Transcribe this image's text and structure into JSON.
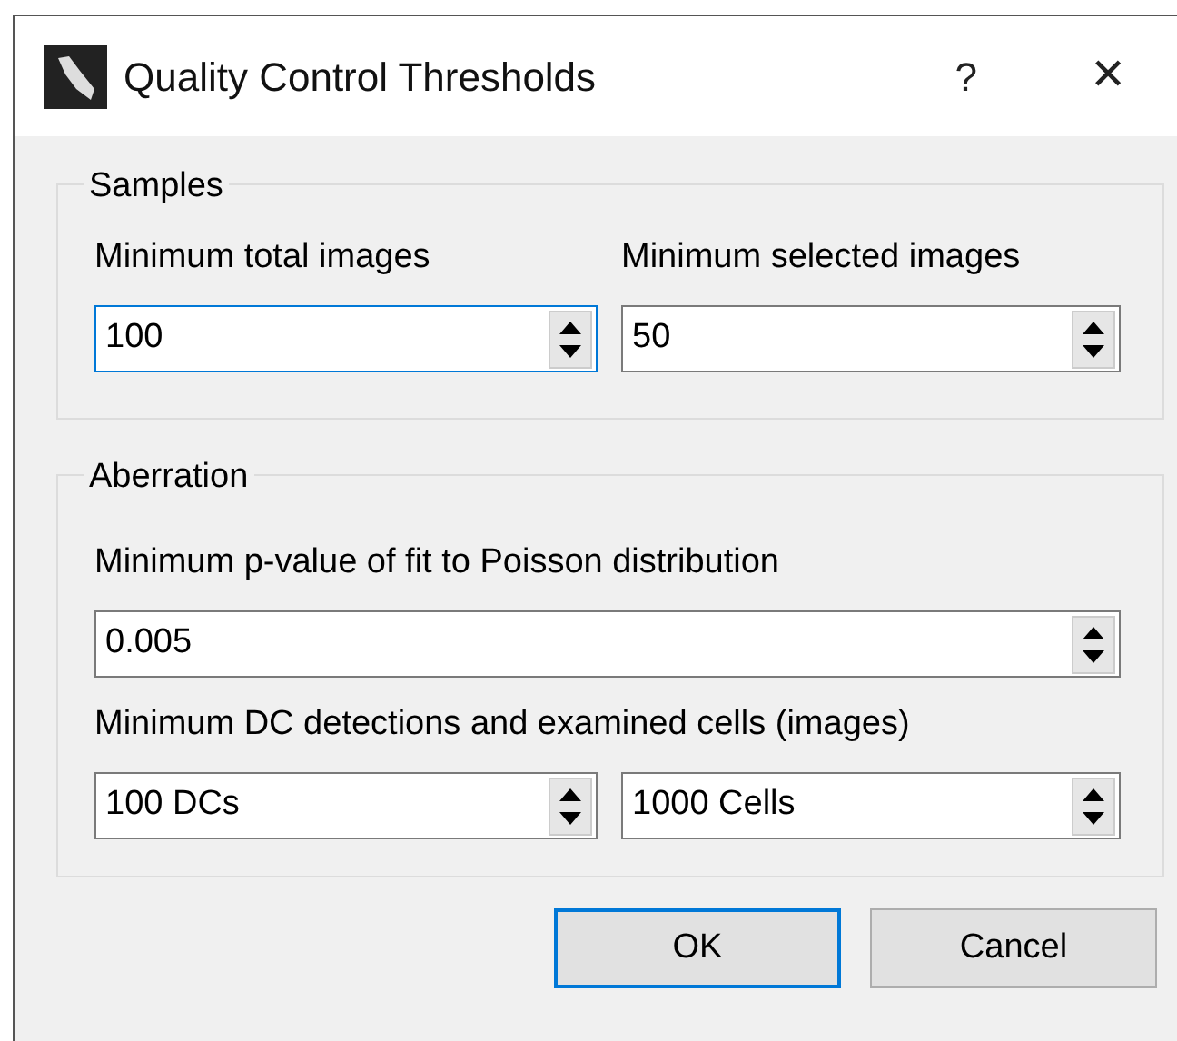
{
  "window": {
    "title": "Quality Control Thresholds",
    "help": "?",
    "close": "✕"
  },
  "groups": [
    {
      "title": "Samples",
      "rows": [
        {
          "kind": "pair",
          "items": [
            {
              "label": "Minimum total images",
              "value": "100",
              "focused": true
            },
            {
              "label": "Minimum selected images",
              "value": "50",
              "focused": false
            }
          ]
        }
      ]
    },
    {
      "title": "Aberration",
      "rows": [
        {
          "kind": "single",
          "label": "Minimum p-value of fit to Poisson distribution",
          "fields": [
            {
              "value": "0.005",
              "focused": false
            }
          ]
        },
        {
          "kind": "single",
          "label": "Minimum DC detections and examined cells (images)",
          "fields": [
            {
              "value": "100 DCs",
              "focused": false
            },
            {
              "value": "1000 Cells",
              "focused": false
            }
          ]
        }
      ]
    }
  ],
  "buttons": [
    {
      "label": "OK",
      "default": true
    },
    {
      "label": "Cancel",
      "default": false
    }
  ]
}
